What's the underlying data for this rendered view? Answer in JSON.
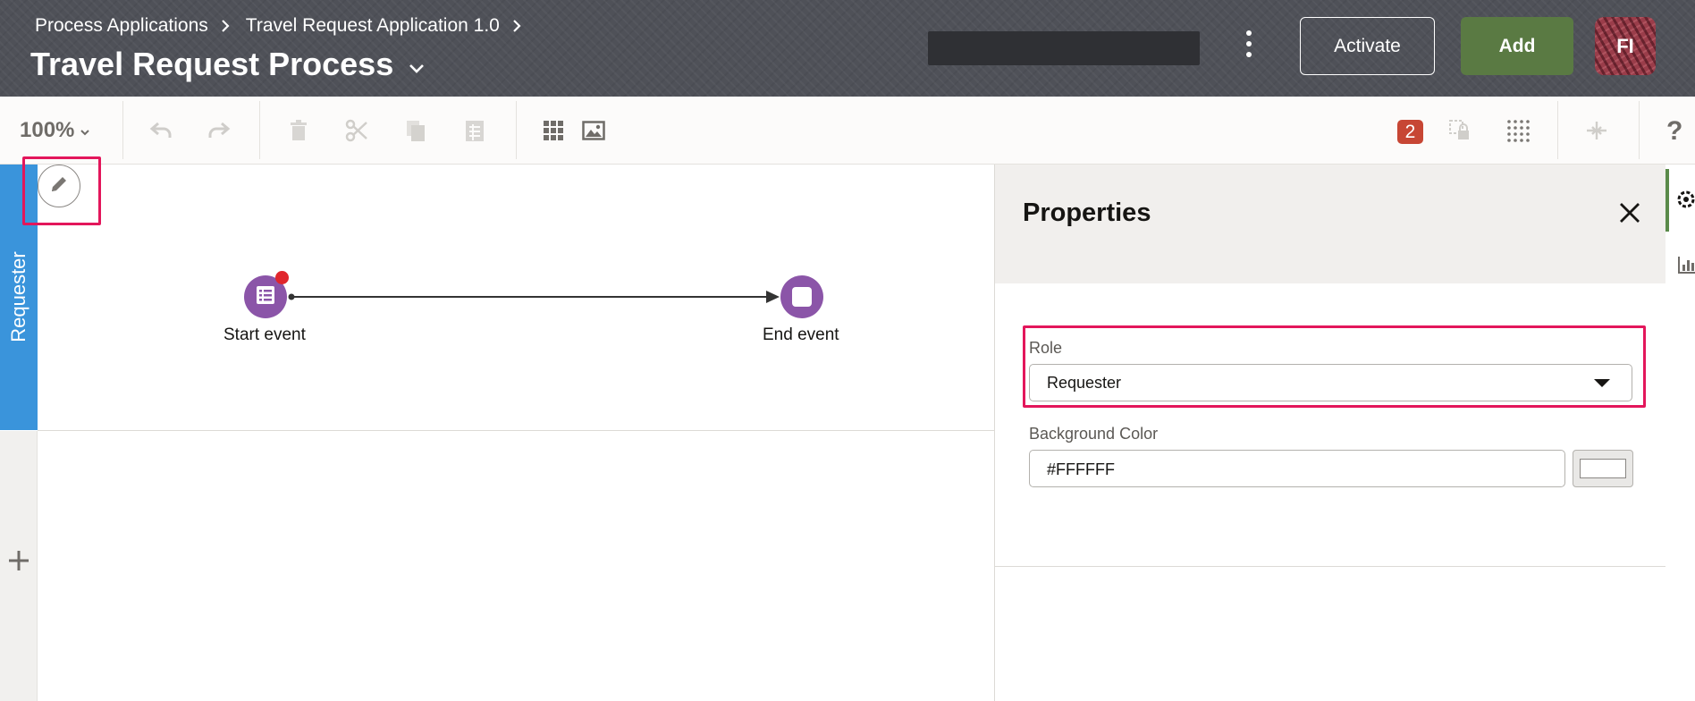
{
  "header": {
    "breadcrumb": [
      "Process Applications",
      "Travel Request Application 1.0"
    ],
    "title": "Travel Request Process",
    "activate_label": "Activate",
    "add_label": "Add",
    "avatar_initials": "FI"
  },
  "toolbar": {
    "zoom": "100%",
    "error_count": "2",
    "help": "?"
  },
  "canvas": {
    "lane_label": "Requester",
    "start_event_label": "Start event",
    "end_event_label": "End event"
  },
  "properties": {
    "title": "Properties",
    "role_label": "Role",
    "role_value": "Requester",
    "bg_color_label": "Background Color",
    "bg_color_value": "#FFFFFF"
  },
  "colors": {
    "header_bg": "#4f5158",
    "lane_blue": "#3a94db",
    "event_purple": "#8b55a8",
    "add_green": "#5a7a43",
    "highlight": "#e3165b",
    "error_badge": "#c74634"
  }
}
